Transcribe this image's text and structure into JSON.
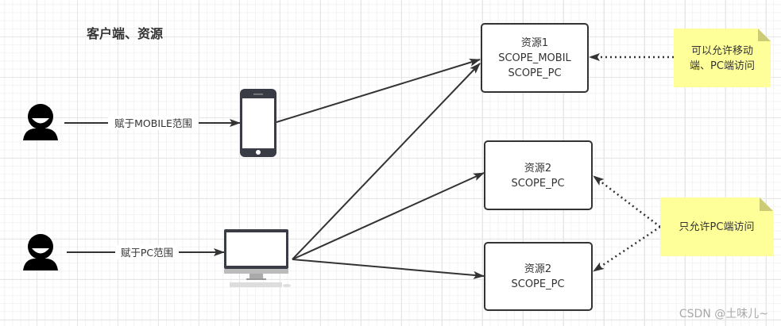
{
  "title": "客户端、资源",
  "edges": {
    "mobile_label": "赋于MOBILE范围",
    "pc_label": "赋于PC范围"
  },
  "resources": [
    {
      "name": "资源1",
      "scope1": "SCOPE_MOBIL",
      "scope2": "SCOPE_PC"
    },
    {
      "name": "资源2",
      "scope1": "SCOPE_PC"
    },
    {
      "name": "资源2",
      "scope1": "SCOPE_PC"
    }
  ],
  "notes": [
    {
      "line1": "可以允许移动",
      "line2": "端、PC端访问"
    },
    {
      "line1": "只允许PC端访问"
    }
  ],
  "watermark": "CSDN @土味儿~",
  "colors": {
    "note_fill": "#ffff99",
    "note_fold": "#cccc77",
    "stroke": "#333333"
  }
}
